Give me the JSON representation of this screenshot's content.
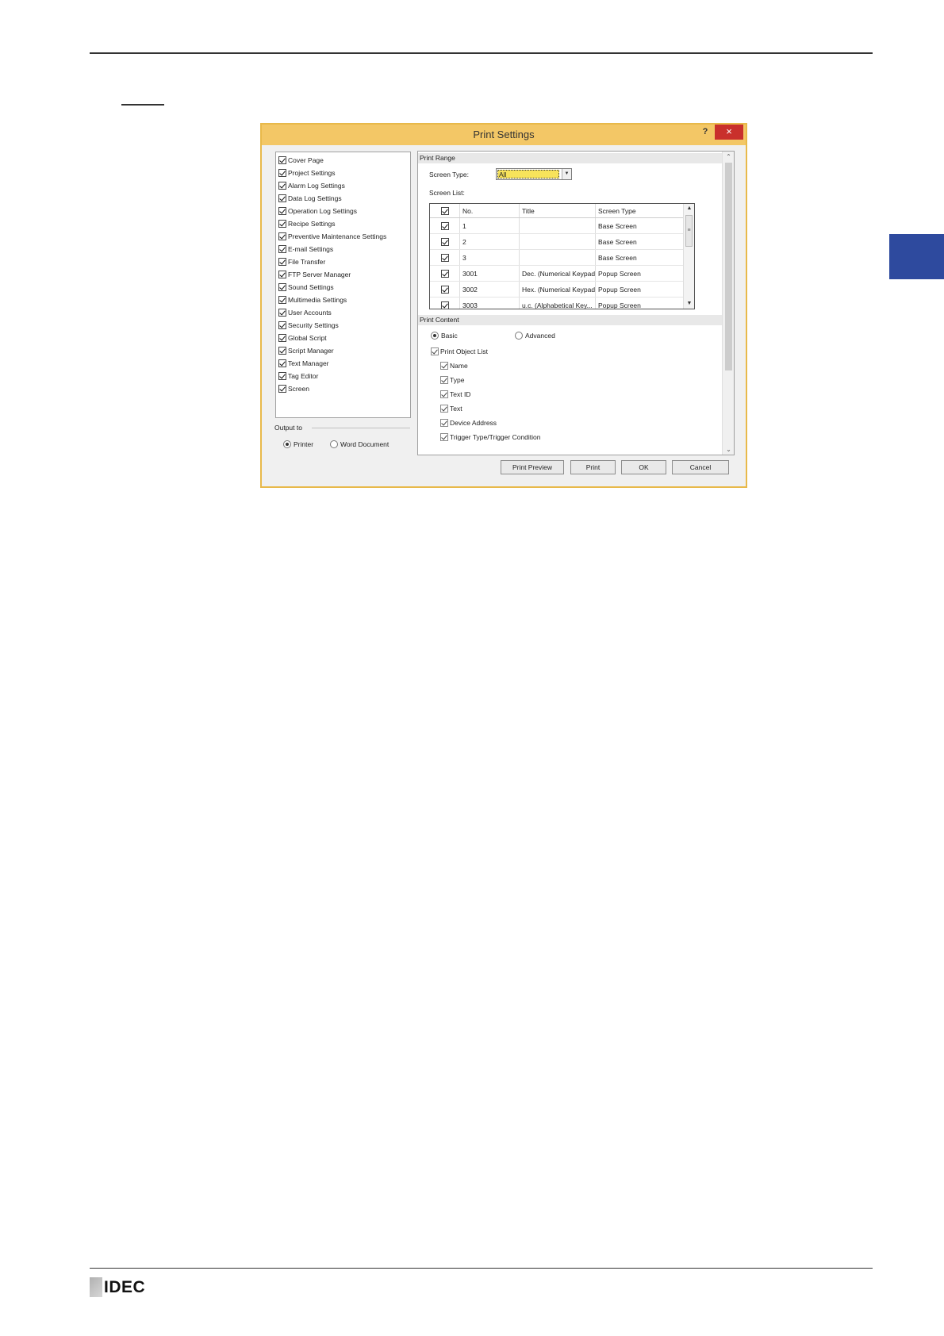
{
  "brand": {
    "logo_text": "IDEC"
  },
  "dialog": {
    "title": "Print Settings",
    "help_glyph": "?",
    "close_glyph": "×",
    "left_items": [
      {
        "label": "Cover Page",
        "checked": true
      },
      {
        "label": "Project Settings",
        "checked": true
      },
      {
        "label": "Alarm Log Settings",
        "checked": true
      },
      {
        "label": "Data Log Settings",
        "checked": true
      },
      {
        "label": "Operation Log Settings",
        "checked": true
      },
      {
        "label": "Recipe Settings",
        "checked": true
      },
      {
        "label": "Preventive Maintenance Settings",
        "checked": true
      },
      {
        "label": "E-mail Settings",
        "checked": true
      },
      {
        "label": "File Transfer",
        "checked": true
      },
      {
        "label": "FTP Server Manager",
        "checked": true
      },
      {
        "label": "Sound Settings",
        "checked": true
      },
      {
        "label": "Multimedia Settings",
        "checked": true
      },
      {
        "label": "User Accounts",
        "checked": true
      },
      {
        "label": "Security Settings",
        "checked": true
      },
      {
        "label": "Global Script",
        "checked": true
      },
      {
        "label": "Script Manager",
        "checked": true
      },
      {
        "label": "Text Manager",
        "checked": true
      },
      {
        "label": "Tag Editor",
        "checked": true
      },
      {
        "label": "Screen",
        "checked": true
      }
    ],
    "output_to": {
      "label": "Output to",
      "options": [
        {
          "label": "Printer",
          "selected": true
        },
        {
          "label": "Word Document",
          "selected": false
        }
      ]
    },
    "print_range": {
      "header": "Print Range",
      "screen_type_label": "Screen Type:",
      "screen_type_value": "All",
      "screen_list_label": "Screen List:",
      "columns": [
        "No.",
        "Title",
        "Screen Type"
      ],
      "rows": [
        {
          "checked": true,
          "no": "1",
          "title": "",
          "type": "Base Screen"
        },
        {
          "checked": true,
          "no": "2",
          "title": "",
          "type": "Base Screen"
        },
        {
          "checked": true,
          "no": "3",
          "title": "",
          "type": "Base Screen"
        },
        {
          "checked": true,
          "no": "3001",
          "title": "Dec. (Numerical Keypad)",
          "type": "Popup Screen"
        },
        {
          "checked": true,
          "no": "3002",
          "title": "Hex. (Numerical Keypad)",
          "type": "Popup Screen"
        },
        {
          "checked": true,
          "no": "3003",
          "title": "u.c. (Alphabetical Key...",
          "type": "Popup Screen"
        }
      ]
    },
    "print_content": {
      "header": "Print Content",
      "mode_options": [
        {
          "label": "Basic",
          "selected": true
        },
        {
          "label": "Advanced",
          "selected": false
        }
      ],
      "object_list_label": "Print Object List",
      "object_list_checked": true,
      "fields": [
        {
          "label": "Name",
          "checked": true
        },
        {
          "label": "Type",
          "checked": true
        },
        {
          "label": "Text ID",
          "checked": true
        },
        {
          "label": "Text",
          "checked": true
        },
        {
          "label": "Device Address",
          "checked": true
        },
        {
          "label": "Trigger Type/Trigger Condition",
          "checked": true
        }
      ]
    },
    "buttons": {
      "print_preview": "Print Preview",
      "print": "Print",
      "ok": "OK",
      "cancel": "Cancel"
    }
  }
}
